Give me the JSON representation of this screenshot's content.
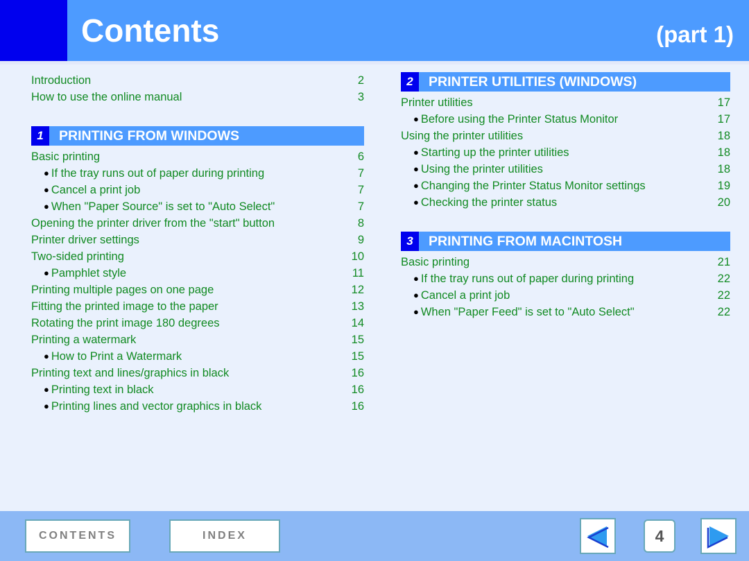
{
  "header": {
    "title": "Contents",
    "part": "(part 1)",
    "accent_block_color": "#0000ee",
    "bar_color": "#4d9bff"
  },
  "colors": {
    "background": "#eaf1fd",
    "link_text": "#118a22",
    "section_bar": "#4d9bff",
    "section_num_box": "#0000ee",
    "footer_bar": "#8cb8f5",
    "button_border": "#68a8b8",
    "button_text": "#808080",
    "arrow_fill": "#2e9bf0",
    "arrow_outline": "#1a3fd0"
  },
  "left_column": {
    "intro_entries": [
      {
        "label": "Introduction",
        "page": "2"
      },
      {
        "label": "How to use the online manual",
        "page": "3"
      }
    ],
    "section": {
      "number": "1",
      "title": "PRINTING FROM WINDOWS",
      "entries": [
        {
          "label": "Basic printing",
          "page": "6",
          "sub": false
        },
        {
          "label": "If the tray runs out of paper during printing",
          "page": "7",
          "sub": true
        },
        {
          "label": "Cancel a print job",
          "page": "7",
          "sub": true
        },
        {
          "label": "When \"Paper Source\" is set to \"Auto Select\"",
          "page": "7",
          "sub": true
        },
        {
          "label": "Opening the printer driver from the \"start\" button",
          "page": "8",
          "sub": false
        },
        {
          "label": "Printer driver settings",
          "page": "9",
          "sub": false
        },
        {
          "label": "Two-sided printing",
          "page": "10",
          "sub": false
        },
        {
          "label": "Pamphlet style",
          "page": "11",
          "sub": true
        },
        {
          "label": "Printing multiple pages on one page",
          "page": "12",
          "sub": false
        },
        {
          "label": "Fitting the printed image to the paper",
          "page": "13",
          "sub": false
        },
        {
          "label": "Rotating the print image 180 degrees",
          "page": "14",
          "sub": false
        },
        {
          "label": "Printing a watermark",
          "page": "15",
          "sub": false
        },
        {
          "label": "How to Print a Watermark",
          "page": "15",
          "sub": true
        },
        {
          "label": "Printing text and lines/graphics in black",
          "page": "16",
          "sub": false
        },
        {
          "label": "Printing text in black",
          "page": "16",
          "sub": true
        },
        {
          "label": "Printing lines and vector graphics in black",
          "page": "16",
          "sub": true
        }
      ]
    }
  },
  "right_column": {
    "section_2": {
      "number": "2",
      "title": "PRINTER UTILITIES (WINDOWS)",
      "entries": [
        {
          "label": "Printer utilities",
          "page": "17",
          "sub": false
        },
        {
          "label": "Before using the Printer Status Monitor",
          "page": "17",
          "sub": true
        },
        {
          "label": "Using the printer utilities",
          "page": "18",
          "sub": false
        },
        {
          "label": "Starting up the printer utilities",
          "page": "18",
          "sub": true
        },
        {
          "label": "Using the printer utilities",
          "page": "18",
          "sub": true
        },
        {
          "label": "Changing the Printer Status Monitor settings",
          "page": "19",
          "sub": true
        },
        {
          "label": "Checking the printer status",
          "page": "20",
          "sub": true
        }
      ]
    },
    "section_3": {
      "number": "3",
      "title": "PRINTING FROM MACINTOSH",
      "entries": [
        {
          "label": "Basic printing",
          "page": "21",
          "sub": false
        },
        {
          "label": "If the tray runs out of paper during printing",
          "page": "22",
          "sub": true
        },
        {
          "label": "Cancel a print job",
          "page": "22",
          "sub": true
        },
        {
          "label": "When \"Paper Feed\" is set to \"Auto Select\"",
          "page": "22",
          "sub": true
        }
      ]
    }
  },
  "footer": {
    "contents_label": "CONTENTS",
    "index_label": "INDEX",
    "page_number": "4",
    "prev_icon": "triangle-left-icon",
    "next_icon": "triangle-right-icon"
  }
}
